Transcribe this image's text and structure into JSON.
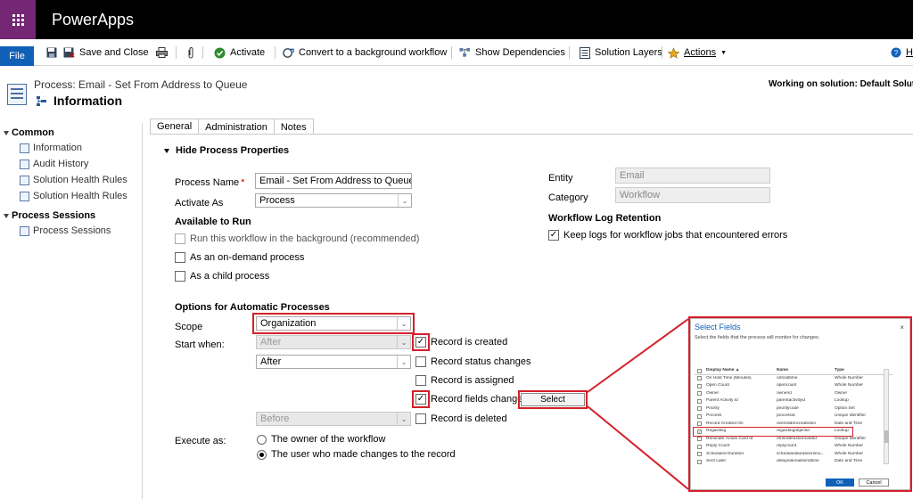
{
  "app": {
    "name": "PowerApps"
  },
  "colors": {
    "brand_purple": "#742774",
    "accent_blue": "#1160b7",
    "highlight_red": "#d4202a"
  },
  "ribbon": {
    "file": "File",
    "save_close": "Save and Close",
    "activate": "Activate",
    "convert": "Convert to a background workflow",
    "show_dependencies": "Show Dependencies",
    "solution_layers": "Solution Layers",
    "actions": "Actions",
    "help": "He"
  },
  "header": {
    "process_title": "Process: Email - Set From Address to Queue",
    "form_title": "Information",
    "solution": "Working on solution: Default Soluti"
  },
  "leftnav": {
    "common": "Common",
    "common_items": [
      "Information",
      "Audit History",
      "Solution Health Rules",
      "Solution Health Rules"
    ],
    "process_sessions": "Process Sessions",
    "process_items": [
      "Process Sessions"
    ]
  },
  "tabs": [
    "General",
    "Administration",
    "Notes"
  ],
  "form": {
    "section_header": "Hide Process Properties",
    "process_name_label": "Process Name",
    "process_name_value": "Email - Set From Address to Queue",
    "activate_as_label": "Activate As",
    "activate_as_value": "Process",
    "available_to_run": "Available to Run",
    "run_background": "Run this workflow in the background (recommended)",
    "on_demand": "As an on-demand process",
    "child_process": "As a child process",
    "entity_label": "Entity",
    "entity_value": "Email",
    "category_label": "Category",
    "category_value": "Workflow",
    "log_retention_header": "Workflow Log Retention",
    "keep_logs": "Keep logs for workflow jobs that encountered errors",
    "options_header": "Options for Automatic Processes",
    "scope_label": "Scope",
    "scope_value": "Organization",
    "start_when_label": "Start when:",
    "after_1": "After",
    "after_2": "After",
    "before": "Before",
    "record_created": "Record is created",
    "record_status": "Record status changes",
    "record_assigned": "Record is assigned",
    "record_fields": "Record fields change",
    "select_button": "Select",
    "record_deleted": "Record is deleted",
    "execute_as_label": "Execute as:",
    "owner_option": "The owner of the workflow",
    "user_option": "The user who made changes to the record"
  },
  "dialog": {
    "title": "Select Fields",
    "close": "×",
    "description": "Select the fields that the process will monitor for changes.",
    "columns": [
      "Display Name ▲",
      "Name",
      "Type"
    ],
    "rows": [
      {
        "display": "On Hold Time (Minutes)",
        "name": "onholdtime",
        "type": "Whole Number",
        "checked": false
      },
      {
        "display": "Open Count",
        "name": "opencount",
        "type": "Whole Number",
        "checked": false
      },
      {
        "display": "Owner",
        "name": "ownerid",
        "type": "Owner",
        "checked": false
      },
      {
        "display": "Parent Activity Id",
        "name": "parentactivityid",
        "type": "Lookup",
        "checked": false
      },
      {
        "display": "Priority",
        "name": "prioritycode",
        "type": "Option Set",
        "checked": false
      },
      {
        "display": "Process",
        "name": "processid",
        "type": "Unique Identifier",
        "checked": false
      },
      {
        "display": "Record Created On",
        "name": "overriddencreatedon",
        "type": "Date and Time",
        "checked": false
      },
      {
        "display": "Regarding",
        "name": "regardingobjectid",
        "type": "Lookup",
        "checked": true
      },
      {
        "display": "Reminder Action Card Id",
        "name": "reminderactioncardid",
        "type": "Unique Identifier",
        "checked": false
      },
      {
        "display": "Reply Count",
        "name": "replycount",
        "type": "Whole Number",
        "checked": false
      },
      {
        "display": "Scheduled Duration",
        "name": "scheduleddurationminu...",
        "type": "Whole Number",
        "checked": false
      },
      {
        "display": "Sent Later",
        "name": "delayedemailsendtime",
        "type": "Date and Time",
        "checked": false
      }
    ],
    "ok": "OK",
    "cancel": "Cancel"
  }
}
